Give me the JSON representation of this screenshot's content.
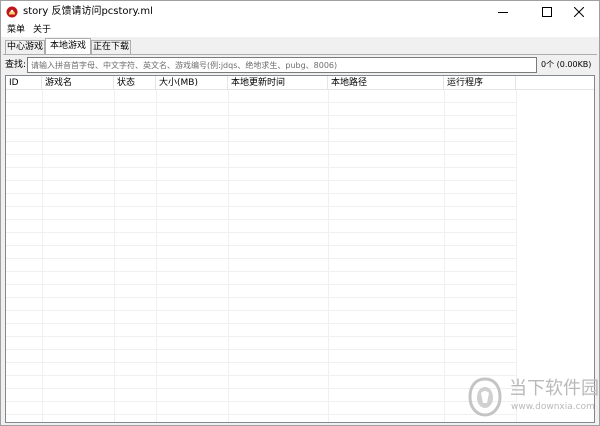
{
  "window": {
    "title": "story 反馈请访问pcstory.ml",
    "app_icon": "red-seal-icon",
    "controls": {
      "minimize": "minimize-icon",
      "maximize": "maximize-icon",
      "close": "close-icon"
    }
  },
  "menu": {
    "items": [
      "菜单",
      "关于"
    ]
  },
  "tabs": {
    "items": [
      "中心游戏",
      "本地游戏",
      "正在下载"
    ],
    "active": "本地游戏"
  },
  "search": {
    "label": "查找:",
    "value": "",
    "placeholder": "请输入拼音首字母、中文字符、英文名、游戏编号(例:jdqs、绝地求生、pubg、8006)"
  },
  "stats": {
    "count_text": "0个 (0.00KB)"
  },
  "table": {
    "columns": [
      "ID",
      "游戏名",
      "状态",
      "大小(MB)",
      "本地更新时间",
      "本地路径",
      "运行程序"
    ],
    "rows": []
  },
  "watermark": {
    "name": "当下软件园",
    "url": "www.downxia.com"
  },
  "colors": {
    "window_bg": "#f0f0f0",
    "border": "#a0a0a0",
    "app_icon_red": "#c0161b",
    "watermark": "#b9b9b9"
  }
}
